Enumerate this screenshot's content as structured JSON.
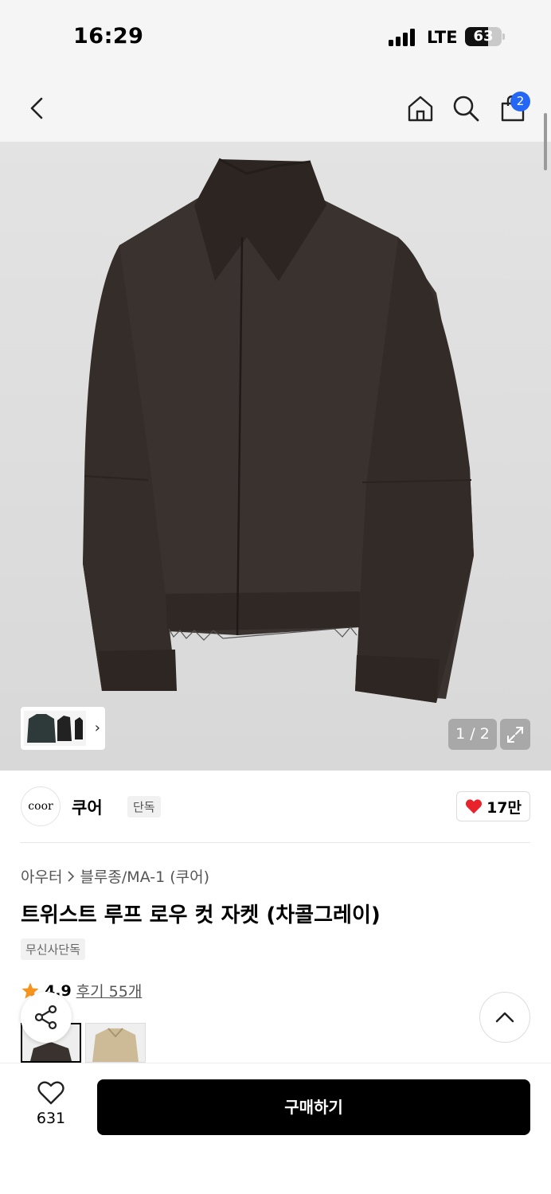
{
  "status_bar": {
    "time": "16:29",
    "network": "LTE",
    "battery": "63"
  },
  "nav": {
    "cart_count": "2"
  },
  "gallery": {
    "counter": "1 / 2"
  },
  "brand": {
    "logo_text": "coor",
    "name": "쿠어",
    "tag": "단독",
    "likes": "17만"
  },
  "product": {
    "breadcrumb_category": "아우터",
    "breadcrumb_sub": "블루종/MA-1 (쿠어)",
    "title": "트위스트 루프 로우 컷 자켓 (차콜그레이)",
    "exclusive_tag": "무신사단독",
    "rating": "4.9",
    "reviews": "후기 55개"
  },
  "bottom_bar": {
    "wish_count": "631",
    "buy_label": "구매하기"
  },
  "colors": {
    "accent_blue": "#2466f5",
    "heart_red": "#e8232c",
    "star_orange": "#f7941d"
  }
}
